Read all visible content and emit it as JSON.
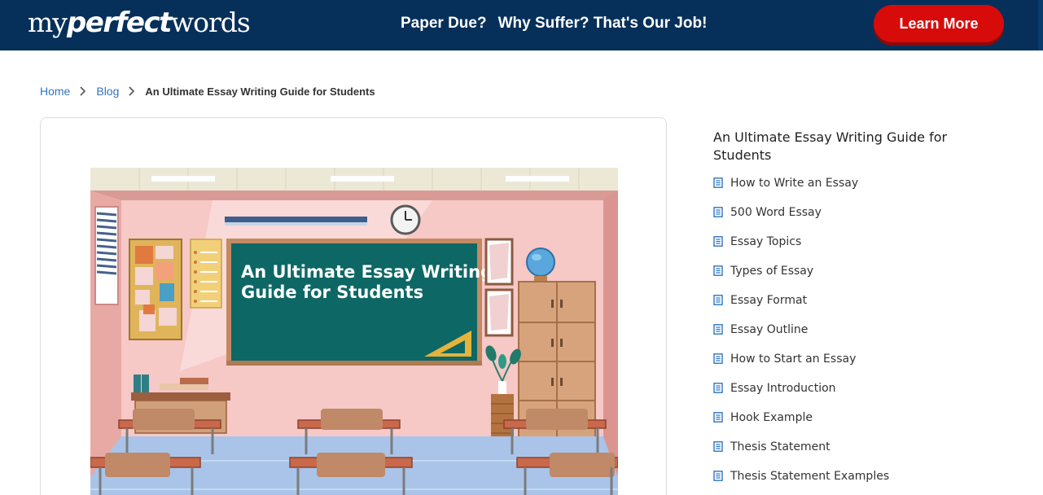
{
  "header": {
    "logo": {
      "part1": "my",
      "part2": "perfect",
      "part3": "words"
    },
    "tagline_1": "Paper Due?",
    "tagline_2": "Why Suffer? That's Our Job!",
    "cta_label": "Learn More",
    "background_color": "#06305a",
    "cta_color": "#d80b0b"
  },
  "breadcrumb": {
    "home": "Home",
    "blog": "Blog",
    "current": "An Ultimate Essay Writing Guide for Students",
    "link_color": "#2f74c0"
  },
  "hero": {
    "title_line1": "An Ultimate Essay Writing",
    "title_line2": "Guide for Students"
  },
  "toc": {
    "title": "An Ultimate Essay Writing Guide for Students",
    "items": [
      {
        "label": "How to Write an Essay",
        "icon": "document-icon"
      },
      {
        "label": "500 Word Essay",
        "icon": "document-icon"
      },
      {
        "label": "Essay Topics",
        "icon": "document-icon"
      },
      {
        "label": "Types of Essay",
        "icon": "document-icon"
      },
      {
        "label": "Essay Format",
        "icon": "document-icon"
      },
      {
        "label": "Essay Outline",
        "icon": "document-icon"
      },
      {
        "label": "How to Start an Essay",
        "icon": "document-icon"
      },
      {
        "label": "Essay Introduction",
        "icon": "document-icon"
      },
      {
        "label": "Hook Example",
        "icon": "document-icon"
      },
      {
        "label": "Thesis Statement",
        "icon": "document-icon"
      },
      {
        "label": "Thesis Statement Examples",
        "icon": "document-icon"
      }
    ],
    "icon_color": "#2f74c0"
  }
}
